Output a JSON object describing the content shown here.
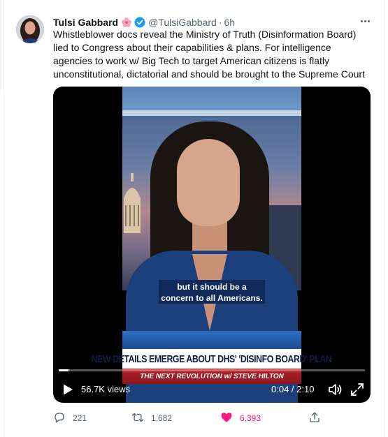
{
  "tweet": {
    "author_name": "Tulsi Gabbard",
    "handle": "@TulsiGabbard",
    "separator": "·",
    "time": "6h",
    "text": "Whistleblower docs reveal the Ministry of Truth (Disinformation Board) lied to Congress about their capabilities & plans. For intelligence agencies to work w/ Big Tech to target American citizens is flatly unconstitutional, dictatorial and should be brought to the Supreme Court"
  },
  "video": {
    "caption_line1": "but it should be a",
    "caption_line2": "concern to all Americans.",
    "chyron": "NEW DETAILS EMERGE ABOUT DHS' 'DISINFO BOARD' PLAN",
    "show_name": "THE NEXT REVOLUTION w/ STEVE HILTON",
    "views": "56.7K views",
    "timer": "0:04 / 2:10",
    "progress": 0.031
  },
  "actions": {
    "replies": "221",
    "retweets": "1,682",
    "likes": "6,393"
  },
  "colors": {
    "like_pink": "#f91880",
    "verified_blue": "#1d9bf0",
    "secondary_text": "#536471"
  },
  "icons": [
    "flower-emoji-icon",
    "verified-badge-icon",
    "more-options-icon",
    "play-icon",
    "volume-icon",
    "fullscreen-icon",
    "reply-icon",
    "retweet-icon",
    "like-heart-icon",
    "share-icon"
  ]
}
